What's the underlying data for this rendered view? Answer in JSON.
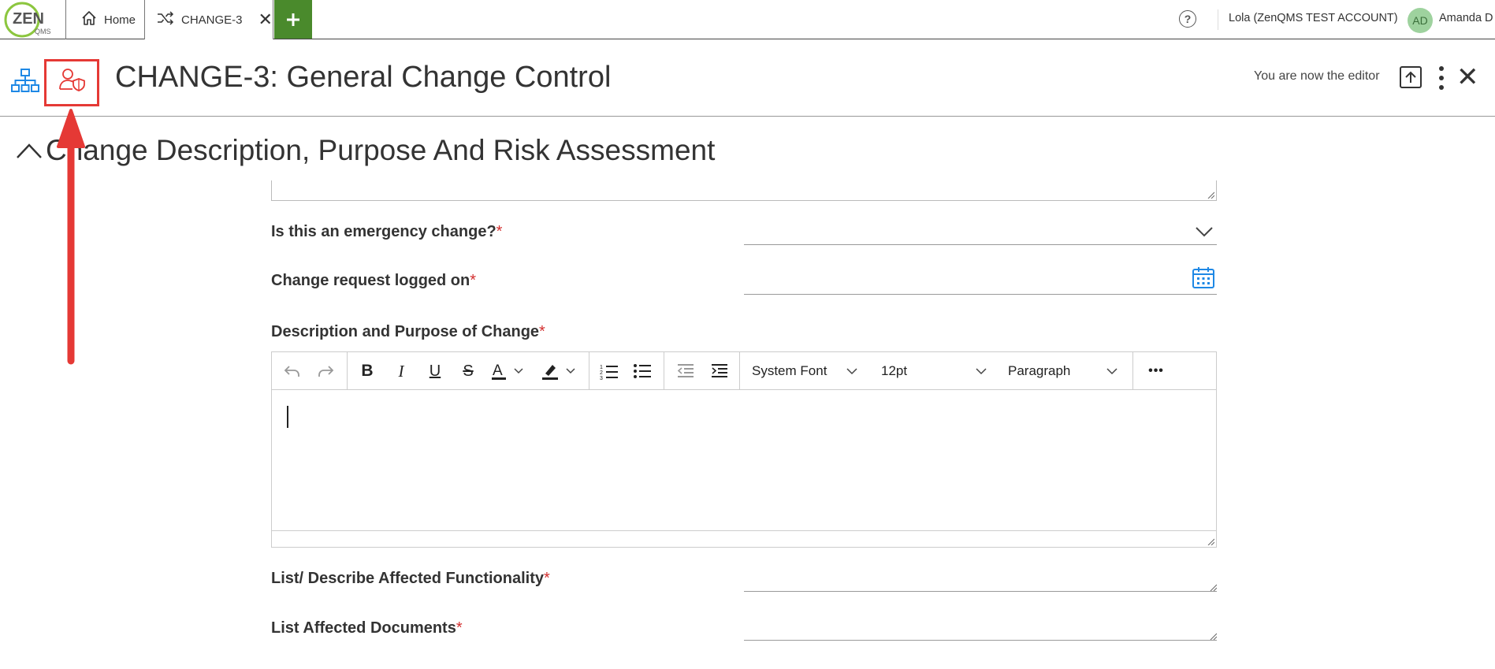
{
  "app": {
    "logo_text": "ZEN",
    "logo_subtext": "QMS"
  },
  "tabs": [
    {
      "label": "Home",
      "icon": "home-icon"
    },
    {
      "label": "CHANGE-3",
      "icon": "shuffle-icon"
    }
  ],
  "topbar": {
    "help_icon": "question-circle-icon",
    "account_label": "Lola (ZenQMS TEST ACCOUNT)",
    "avatar_initials": "AD",
    "user_name": "Amanda D"
  },
  "header": {
    "title": "CHANGE-3: General Change Control",
    "editor_message": "You are now the editor"
  },
  "section": {
    "title": "Change Description, Purpose And Risk Assessment"
  },
  "fields": [
    {
      "label": "Is this an emergency change?",
      "required": "*",
      "type": "select",
      "value": ""
    },
    {
      "label": "Change request logged on",
      "required": "*",
      "type": "date",
      "value": ""
    },
    {
      "label": "Description and Purpose of Change",
      "required": "*",
      "type": "richtext",
      "value": ""
    },
    {
      "label": "List/ Describe Affected Functionality",
      "required": "*",
      "type": "textarea",
      "value": ""
    },
    {
      "label": "List Affected Documents",
      "required": "*",
      "type": "textarea",
      "value": ""
    }
  ],
  "editor_toolbar": {
    "font_family": "System Font",
    "font_size": "12pt",
    "block_format": "Paragraph",
    "more": "•••"
  },
  "colors": {
    "accent_green": "#4a8a2c",
    "highlight_red": "#e53935",
    "icon_blue": "#1e88e5",
    "required_red": "#d32f2f"
  }
}
